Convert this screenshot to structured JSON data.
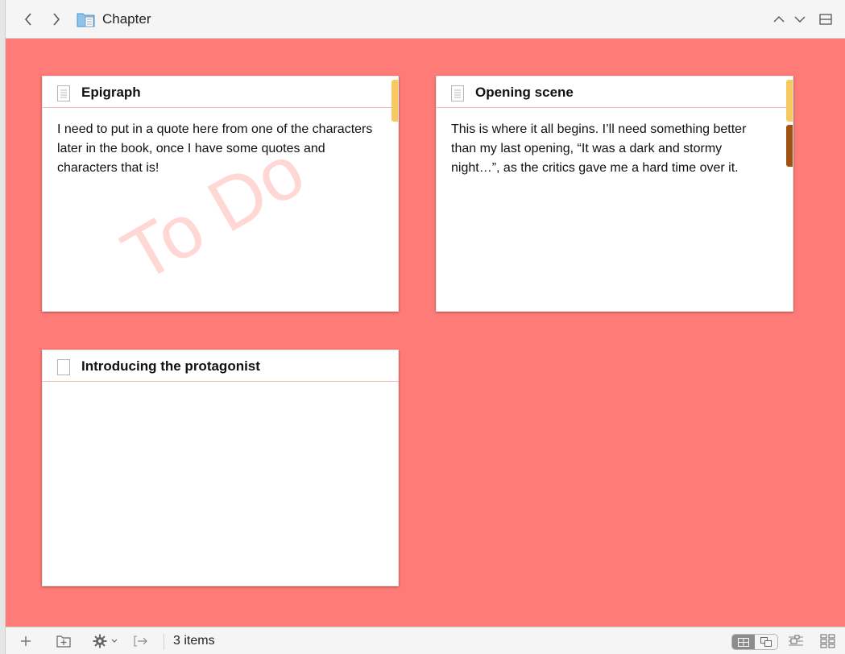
{
  "window": {
    "title": "Chapter"
  },
  "toolbar": {
    "back_icon": "chevron-left",
    "forward_icon": "chevron-right",
    "folder_icon": "folder-document",
    "up_icon": "chevron-up",
    "down_icon": "chevron-down",
    "split_icon": "split-editor"
  },
  "colors": {
    "corkboard": "#ff7b77",
    "label_yellow": "#f7c961",
    "label_brown": "#a05213",
    "stamp": "#ff6e64"
  },
  "cards": [
    {
      "title": "Epigraph",
      "synopsis": "I need to put in a quote here from one of the characters later in the book, once I have some quotes and characters that is!",
      "stamp": "To Do",
      "icon": "text-document",
      "labels": [
        "yellow"
      ]
    },
    {
      "title": "Opening scene",
      "synopsis": "This is where it all begins. I’ll need something better than my last opening, “It was a dark and stormy night…”, as the critics gave me a hard time over it.",
      "icon": "text-document",
      "labels": [
        "yellow",
        "brown"
      ]
    },
    {
      "title": "Introducing the protagonist",
      "synopsis": "",
      "icon": "empty-document",
      "labels": []
    }
  ],
  "footer": {
    "item_count": "3 items",
    "add_icon": "plus",
    "add_folder_icon": "folder-plus",
    "settings_icon": "gear",
    "settings_menu_icon": "chevron-down",
    "export_icon": "arrow-right",
    "grid_view_icon": "grid",
    "freeform_view_icon": "freeform",
    "outline_view_icon": "outliner",
    "corkboard_view_icon": "corkboard-options"
  }
}
